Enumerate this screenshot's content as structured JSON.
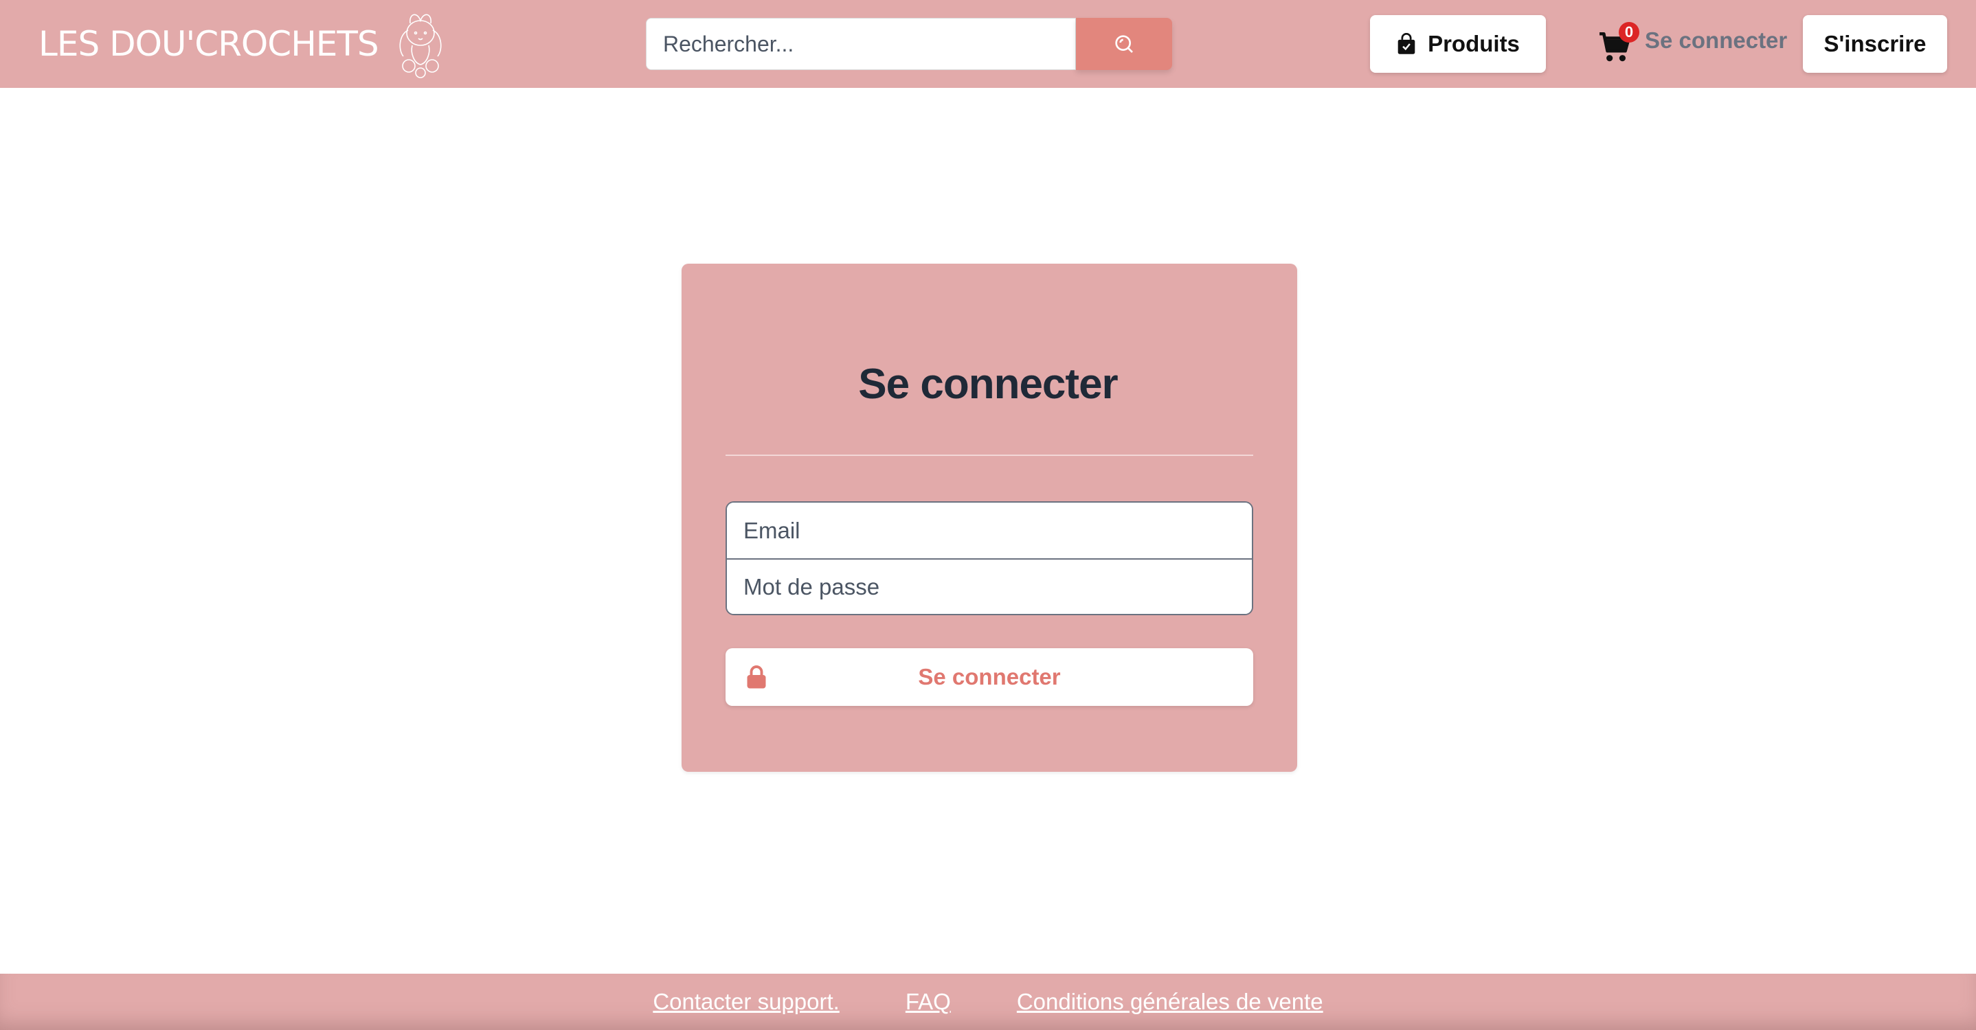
{
  "header": {
    "brand": "LES DOU'CROCHETS",
    "search": {
      "placeholder": "Rechercher...",
      "value": ""
    },
    "products_label": "Produits",
    "cart_count": "0",
    "login_link": "Se connecter",
    "signup_label": "S'inscrire"
  },
  "login_card": {
    "title": "Se connecter",
    "email_placeholder": "Email",
    "password_placeholder": "Mot de passe",
    "submit_label": "Se connecter"
  },
  "footer": {
    "links": [
      "Contacter support.",
      "FAQ",
      "Conditions générales de vente"
    ]
  },
  "colors": {
    "primary_pink": "#e2aaaa",
    "accent_salmon": "#e2867d",
    "badge_red": "#dc2626"
  },
  "icons": {
    "search": "search-icon",
    "bag": "shopping-bag-icon",
    "cart": "cart-icon",
    "lock": "lock-icon",
    "logo": "bunny-logo-icon"
  }
}
